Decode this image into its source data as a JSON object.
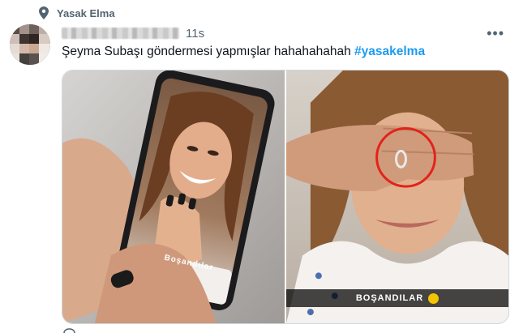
{
  "context": {
    "label": "Yasak Elma",
    "icon": "location-pin-icon"
  },
  "tweet": {
    "timestamp": "11s",
    "text": "Şeyma Subaşı göndermesi yapmışlar hahahahahah ",
    "hashtag": "#yasakelma",
    "more_icon": "more-icon"
  },
  "media": {
    "left_caption": "Boşandılar",
    "right_caption": "BOŞANDILAR"
  },
  "colors": {
    "accent": "#1d9bf0",
    "secondary_text": "#536471",
    "highlight_circle": "#e2231a"
  }
}
